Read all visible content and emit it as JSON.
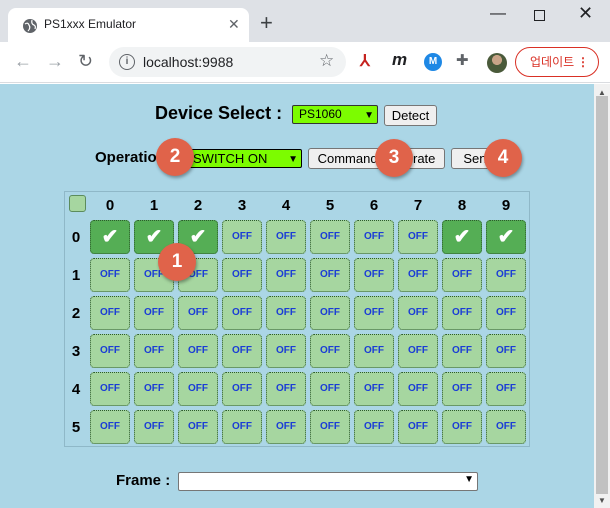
{
  "browser": {
    "tab_title": "PS1xxx Emulator",
    "tab_close": "✕",
    "new_tab": "+",
    "url": "localhost:9988",
    "update_label": "업데이트",
    "update_menu": "⋮"
  },
  "device": {
    "label": "Device Select :",
    "selected": "PS1060",
    "detect_label": "Detect"
  },
  "operation": {
    "label": "Operation :",
    "selected": "SWITCH ON",
    "command_label": "Command Generate",
    "send_label": "Send"
  },
  "badges": [
    "1",
    "2",
    "3",
    "4"
  ],
  "grid": {
    "columns": [
      "0",
      "1",
      "2",
      "3",
      "4",
      "5",
      "6",
      "7",
      "8",
      "9"
    ],
    "rows": [
      {
        "label": "0",
        "cells": [
          "✔",
          "✔",
          "✔",
          "OFF",
          "OFF",
          "OFF",
          "OFF",
          "OFF",
          "✔",
          "✔"
        ],
        "on": [
          true,
          true,
          true,
          false,
          false,
          false,
          false,
          false,
          true,
          true
        ]
      },
      {
        "label": "1",
        "cells": [
          "OFF",
          "OFF",
          "OFF",
          "OFF",
          "OFF",
          "OFF",
          "OFF",
          "OFF",
          "OFF",
          "OFF"
        ],
        "on": [
          false,
          false,
          false,
          false,
          false,
          false,
          false,
          false,
          false,
          false
        ]
      },
      {
        "label": "2",
        "cells": [
          "OFF",
          "OFF",
          "OFF",
          "OFF",
          "OFF",
          "OFF",
          "OFF",
          "OFF",
          "OFF",
          "OFF"
        ],
        "on": [
          false,
          false,
          false,
          false,
          false,
          false,
          false,
          false,
          false,
          false
        ]
      },
      {
        "label": "3",
        "cells": [
          "OFF",
          "OFF",
          "OFF",
          "OFF",
          "OFF",
          "OFF",
          "OFF",
          "OFF",
          "OFF",
          "OFF"
        ],
        "on": [
          false,
          false,
          false,
          false,
          false,
          false,
          false,
          false,
          false,
          false
        ]
      },
      {
        "label": "4",
        "cells": [
          "OFF",
          "OFF",
          "OFF",
          "OFF",
          "OFF",
          "OFF",
          "OFF",
          "OFF",
          "OFF",
          "OFF"
        ],
        "on": [
          false,
          false,
          false,
          false,
          false,
          false,
          false,
          false,
          false,
          false
        ]
      },
      {
        "label": "5",
        "cells": [
          "OFF",
          "OFF",
          "OFF",
          "OFF",
          "OFF",
          "OFF",
          "OFF",
          "OFF",
          "OFF",
          "OFF"
        ],
        "on": [
          false,
          false,
          false,
          false,
          false,
          false,
          false,
          false,
          false,
          false
        ]
      }
    ]
  },
  "frame": {
    "label": "Frame :",
    "selected": ""
  },
  "colors": {
    "page_bg": "#abd6e6",
    "select_green": "#7cfc00",
    "cell_off": "#a6d6a0",
    "cell_on": "#55ae55",
    "off_text": "#1a3cd6",
    "badge": "#e0634a"
  }
}
